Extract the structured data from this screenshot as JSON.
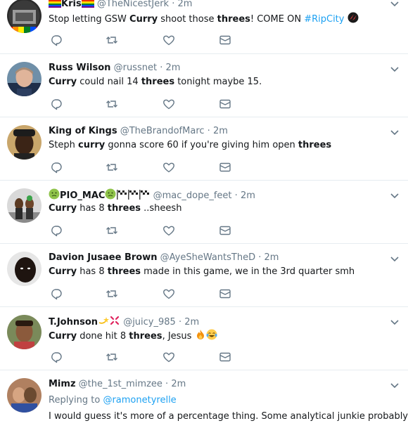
{
  "tweets": [
    {
      "fullname": "Kris",
      "username": "@TheNicestJerk",
      "sep": "·",
      "time": "2m",
      "text": {
        "p1": "Stop letting GSW ",
        "b1": "Curry",
        "p2": " shoot those ",
        "b2": "threes",
        "p3": "! COME ON ",
        "hashtag": "#RipCity"
      }
    },
    {
      "fullname": "Russ Wilson",
      "username": "@russnet",
      "sep": "·",
      "time": "2m",
      "text": {
        "b1": "Curry",
        "p1": " could nail 14 ",
        "b2": "threes",
        "p2": " tonight maybe 15."
      }
    },
    {
      "fullname": "King of Kings",
      "username": "@TheBrandofMarc",
      "sep": "·",
      "time": "2m",
      "text": {
        "p1": "Steph ",
        "b1": "curry",
        "p2": " gonna score 60 if you're giving him open ",
        "b2": "threes"
      }
    },
    {
      "fullname": "PIO_MAC",
      "username": "@mac_dope_feet",
      "sep": "·",
      "time": "2m",
      "text": {
        "b1": "Curry",
        "p1": " has 8 ",
        "b2": "threes",
        "p2": " ..sheesh"
      }
    },
    {
      "fullname": "Davion Jusaee Brown",
      "username": "@AyeSheWantsTheD",
      "sep": "·",
      "time": "2m",
      "text": {
        "b1": "Curry",
        "p1": " has 8 ",
        "b2": "threes",
        "p2": " made in this game, we in the 3rd quarter smh"
      }
    },
    {
      "fullname": "T.Johnson",
      "username": "@juicy_985",
      "sep": "·",
      "time": "2m",
      "text": {
        "b1": "Curry",
        "p1": " done hit 8 ",
        "b2": "threes",
        "p2": ", Jesus "
      }
    },
    {
      "fullname": "Mimz",
      "username": "@the_1st_mimzee",
      "sep": "·",
      "time": "2m",
      "replying_prefix": "Replying to ",
      "replying_to": "@ramonetyrelle",
      "text": {
        "p1": "I would guess it's more of a percentage thing. Some analytical junkie probably"
      }
    }
  ],
  "icons": {
    "reply": "reply-icon",
    "retweet": "retweet-icon",
    "like": "heart-icon",
    "dm": "envelope-icon",
    "caret": "chevron-down-icon"
  },
  "colors": {
    "text": "#14171a",
    "secondary": "#657786",
    "link": "#1da1f2",
    "divider": "#e6ecf0"
  }
}
